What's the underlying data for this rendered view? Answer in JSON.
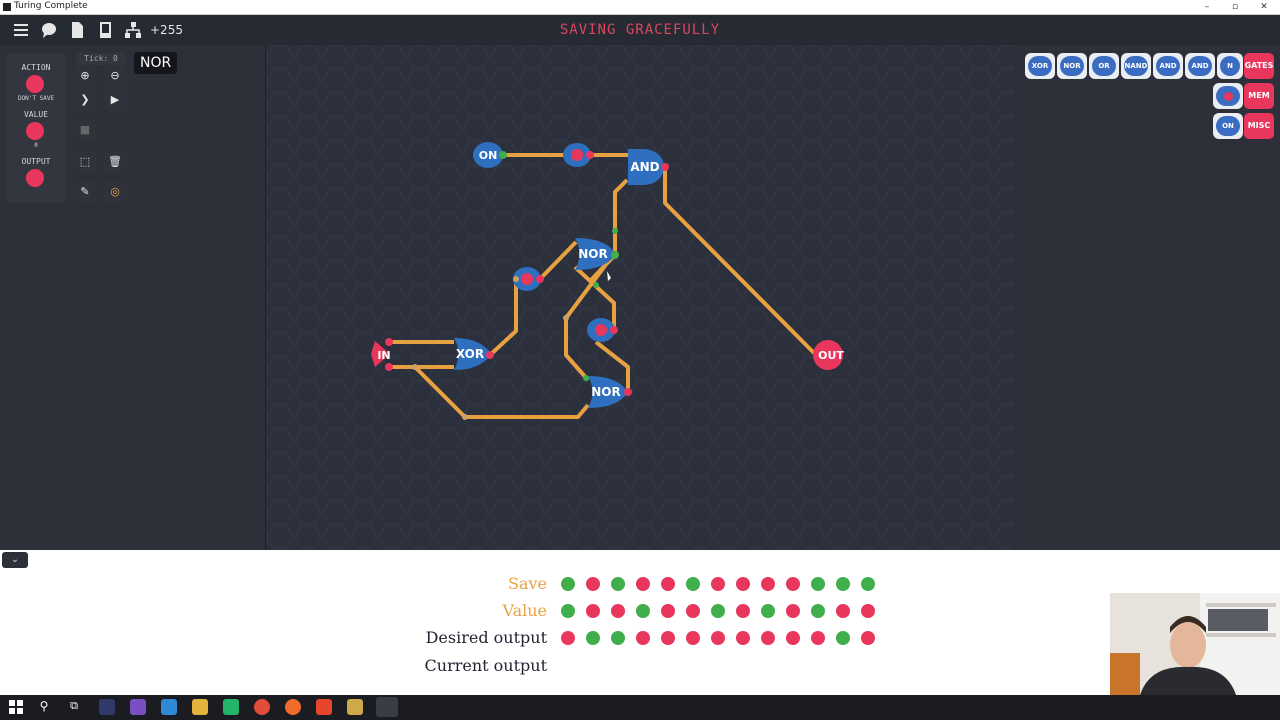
{
  "window": {
    "title": "Turing Complete"
  },
  "toolbar": {
    "count": "+255",
    "level_title": "SAVING GRACEFULLY"
  },
  "left_panel": {
    "action_label": "ACTION",
    "action_sub": "DON'T SAVE",
    "value_label": "VALUE",
    "value_sub": "0",
    "output_label": "OUTPUT",
    "tick": "Tick: 0",
    "tooltip": "NOR"
  },
  "gates": {
    "on": "ON",
    "and": "AND",
    "nor1": "NOR",
    "xor": "XOR",
    "nor2": "NOR",
    "in": "IN",
    "out": "OUT"
  },
  "components": {
    "row1": [
      "XOR",
      "NOR",
      "OR",
      "NAND",
      "AND",
      "AND",
      "N"
    ],
    "categories": [
      "GATES",
      "MEM",
      "MISC"
    ],
    "misc_item": "ON"
  },
  "test_table": {
    "rows": [
      {
        "label": "Save",
        "bits": [
          1,
          0,
          1,
          0,
          0,
          1,
          0,
          0,
          0,
          0,
          1,
          1,
          1
        ]
      },
      {
        "label": "Value",
        "bits": [
          1,
          0,
          0,
          1,
          0,
          0,
          1,
          0,
          1,
          0,
          1,
          0,
          0
        ]
      },
      {
        "label": "Desired output",
        "bits": [
          0,
          1,
          1,
          0,
          0,
          0,
          0,
          0,
          0,
          0,
          0,
          1,
          0
        ]
      },
      {
        "label": "Current output",
        "bits": []
      }
    ]
  },
  "colors": {
    "true": "#3fae4b",
    "false": "#e8365c",
    "wire": "#e8a141",
    "gate": "#2f6fbf"
  }
}
